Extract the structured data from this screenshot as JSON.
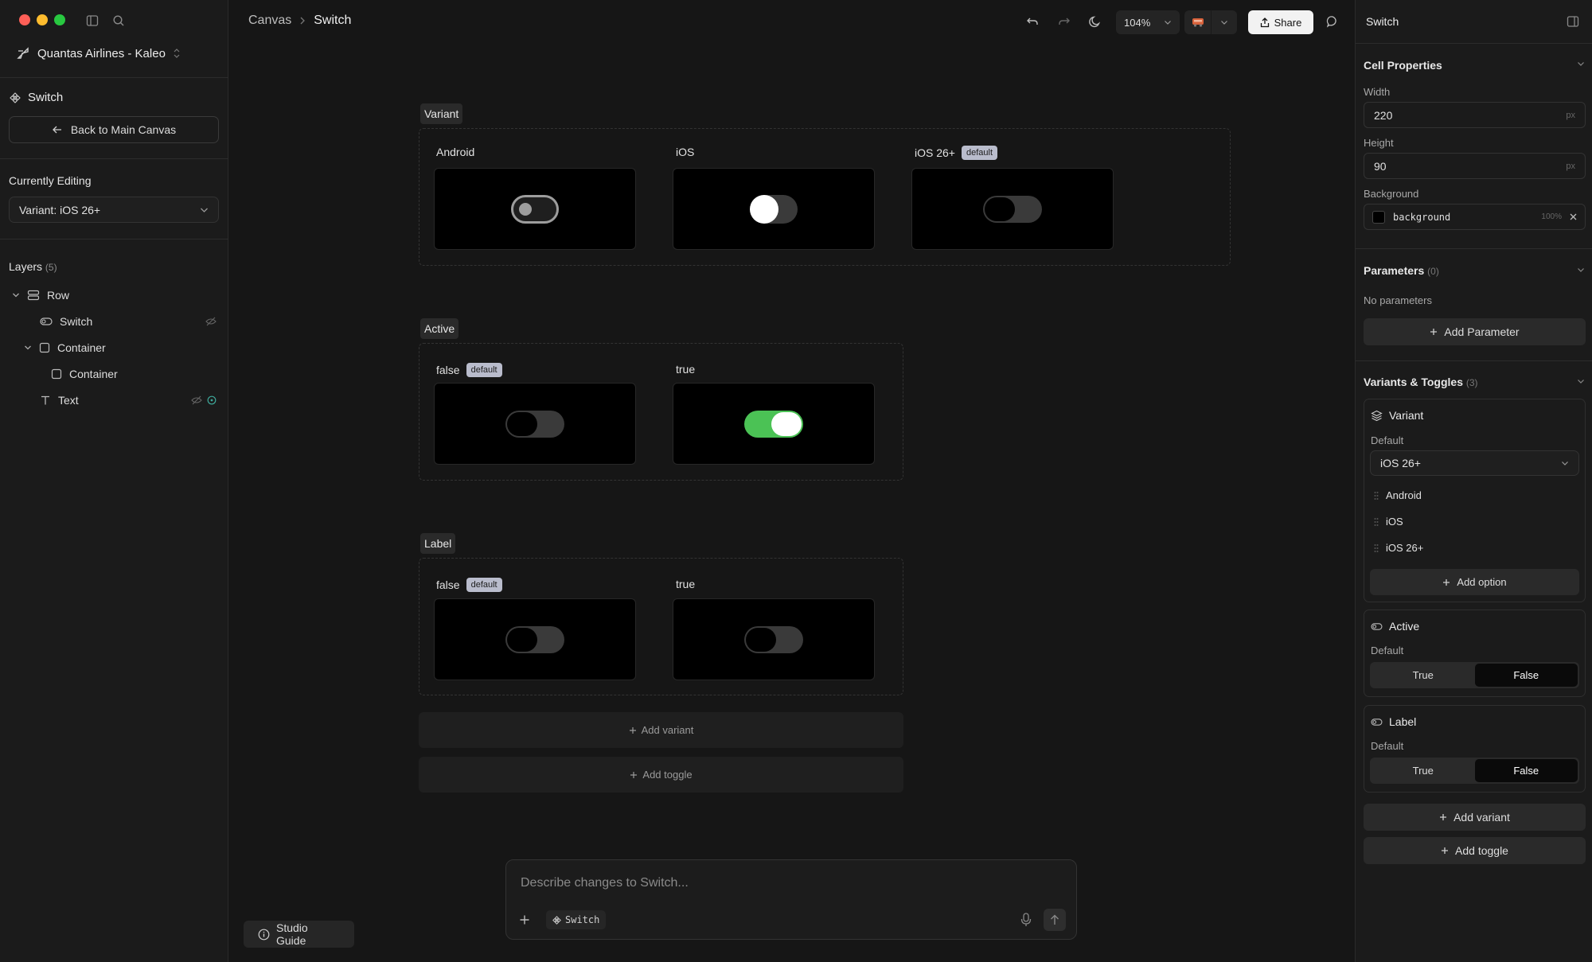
{
  "left": {
    "project_name": "Quantas Airlines - Kaleo",
    "component_name": "Switch",
    "back_button": "Back to Main Canvas",
    "currently_editing_label": "Currently Editing",
    "currently_editing_value": "Variant: iOS 26+",
    "layers_title": "Layers",
    "layers_count": "(5)",
    "layers": [
      "Row",
      "Switch",
      "Container",
      "Container",
      "Text"
    ],
    "studio_guide": "Studio Guide"
  },
  "topbar": {
    "breadcrumb_root": "Canvas",
    "breadcrumb_current": "Switch",
    "zoom": "104%",
    "share": "Share"
  },
  "canvas": {
    "sections": {
      "variant": {
        "title": "Variant",
        "cells": [
          {
            "label": "Android",
            "badge": ""
          },
          {
            "label": "iOS",
            "badge": ""
          },
          {
            "label": "iOS 26+",
            "badge": "default"
          }
        ]
      },
      "active": {
        "title": "Active",
        "cells": [
          {
            "label": "false",
            "badge": "default"
          },
          {
            "label": "true",
            "badge": ""
          }
        ]
      },
      "label": {
        "title": "Label",
        "cells": [
          {
            "label": "false",
            "badge": "default"
          },
          {
            "label": "true",
            "badge": ""
          }
        ]
      }
    },
    "add_variant": "Add variant",
    "add_toggle": "Add toggle",
    "prompt_placeholder": "Describe changes to Switch...",
    "prompt_chip": "Switch"
  },
  "right": {
    "header": "Switch",
    "cell_properties": "Cell Properties",
    "width_label": "Width",
    "width_value": "220",
    "height_label": "Height",
    "height_value": "90",
    "unit": "px",
    "background_label": "Background",
    "background_value": "background",
    "background_opacity": "100%",
    "parameters_title": "Parameters",
    "parameters_count": "(0)",
    "no_parameters": "No parameters",
    "add_parameter": "Add Parameter",
    "variants_title": "Variants & Toggles",
    "variants_count": "(3)",
    "variant_card": {
      "title": "Variant",
      "default_label": "Default",
      "default_value": "iOS 26+",
      "options": [
        "Android",
        "iOS",
        "iOS 26+"
      ],
      "add_option": "Add option"
    },
    "active_card": {
      "title": "Active",
      "default_label": "Default",
      "true": "True",
      "false": "False"
    },
    "label_card": {
      "title": "Label",
      "default_label": "Default",
      "true": "True",
      "false": "False"
    },
    "add_variant": "Add variant",
    "add_toggle": "Add toggle"
  },
  "colors": {
    "accent_green": "#4bc255",
    "badge": "#b9bccc",
    "background": "#161616"
  }
}
